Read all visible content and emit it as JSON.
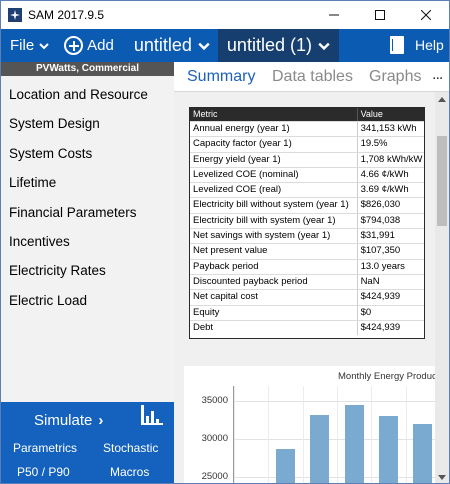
{
  "window": {
    "title": "SAM 2017.9.5"
  },
  "menubar": {
    "file_label": "File",
    "add_label": "Add",
    "case_tabs": [
      {
        "label": "untitled"
      },
      {
        "label": "untitled (1)"
      }
    ],
    "help_label": "Help"
  },
  "sidebar": {
    "config_label": "PVWatts, Commercial",
    "items": [
      {
        "label": "Location and Resource"
      },
      {
        "label": "System Design"
      },
      {
        "label": "System Costs"
      },
      {
        "label": "Lifetime"
      },
      {
        "label": "Financial Parameters"
      },
      {
        "label": "Incentives"
      },
      {
        "label": "Electricity Rates"
      },
      {
        "label": "Electric Load"
      }
    ],
    "simulate_label": "Simulate",
    "links": {
      "parametrics": "Parametrics",
      "stochastic": "Stochastic",
      "p50p90": "P50 / P90",
      "macros": "Macros"
    }
  },
  "main": {
    "tabs": [
      {
        "label": "Summary"
      },
      {
        "label": "Data tables"
      },
      {
        "label": "Graphs"
      }
    ],
    "more_label": "..."
  },
  "metrics_table": {
    "headers": {
      "metric": "Metric",
      "value": "Value"
    },
    "rows": [
      {
        "metric": "Annual energy (year 1)",
        "value": "341,153 kWh"
      },
      {
        "metric": "Capacity factor (year 1)",
        "value": "19.5%"
      },
      {
        "metric": "Energy yield (year 1)",
        "value": "1,708 kWh/kW"
      },
      {
        "metric": "Levelized COE (nominal)",
        "value": "4.66 ¢/kWh"
      },
      {
        "metric": "Levelized COE (real)",
        "value": "3.69 ¢/kWh"
      },
      {
        "metric": "Electricity bill without system (year 1)",
        "value": "$826,030"
      },
      {
        "metric": "Electricity bill with system (year 1)",
        "value": "$794,038"
      },
      {
        "metric": "Net savings with system (year 1)",
        "value": "$31,991"
      },
      {
        "metric": "Net present value",
        "value": "$107,350"
      },
      {
        "metric": "Payback period",
        "value": "13.0 years"
      },
      {
        "metric": "Discounted payback period",
        "value": "NaN"
      },
      {
        "metric": "Net capital cost",
        "value": "$424,939"
      },
      {
        "metric": "Equity",
        "value": "$0"
      },
      {
        "metric": "Debt",
        "value": "$424,939"
      }
    ]
  },
  "chart_data": {
    "type": "bar",
    "title": "Monthly Energy Product",
    "yticks": [
      "35000",
      "30000",
      "25000"
    ],
    "ylim": [
      24000,
      37000
    ],
    "categories": [
      "",
      "",
      "",
      "",
      "",
      ""
    ],
    "values": [
      null,
      28700,
      33200,
      34500,
      33000,
      32000
    ],
    "color": "#7aaacf"
  },
  "colors": {
    "menubar": "#0b5bb2",
    "active_case_tab": "#163f70",
    "simulate_panel": "#1462bd",
    "active_tab": "#1c62b9"
  }
}
